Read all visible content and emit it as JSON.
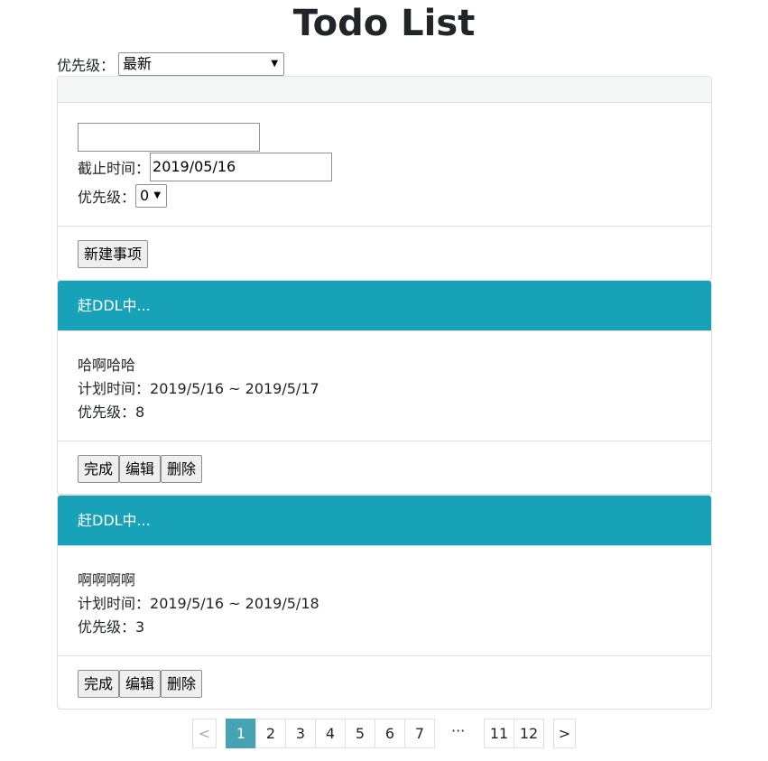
{
  "app": {
    "title": "Todo List"
  },
  "filter": {
    "label": "优先级：",
    "selected": "最新"
  },
  "new_form": {
    "title_value": "",
    "deadline_label": "截止时间：",
    "deadline_value": "2019/05/16",
    "priority_label": "优先级：",
    "priority_value": "0",
    "create_button": "新建事项"
  },
  "tasks": [
    {
      "status": "赶DDL中...",
      "name": "哈啊哈哈",
      "time_label": "计划时间：",
      "time_range": "2019/5/16 ~ 2019/5/17",
      "priority_label": "优先级：",
      "priority": "8"
    },
    {
      "status": "赶DDL中...",
      "name": "啊啊啊啊",
      "time_label": "计划时间：",
      "time_range": "2019/5/16 ~ 2019/5/18",
      "priority_label": "优先级：",
      "priority": "3"
    }
  ],
  "task_actions": {
    "done": "完成",
    "edit": "编辑",
    "delete": "删除"
  },
  "pagination": {
    "prev": "<",
    "next": ">",
    "pages": [
      "1",
      "2",
      "3",
      "4",
      "5",
      "6",
      "7"
    ],
    "ellipsis": "···",
    "last_pages": [
      "11",
      "12"
    ],
    "current": "1"
  },
  "colors": {
    "header_accent": "#17a2b8",
    "active_page": "#45a3b3"
  }
}
